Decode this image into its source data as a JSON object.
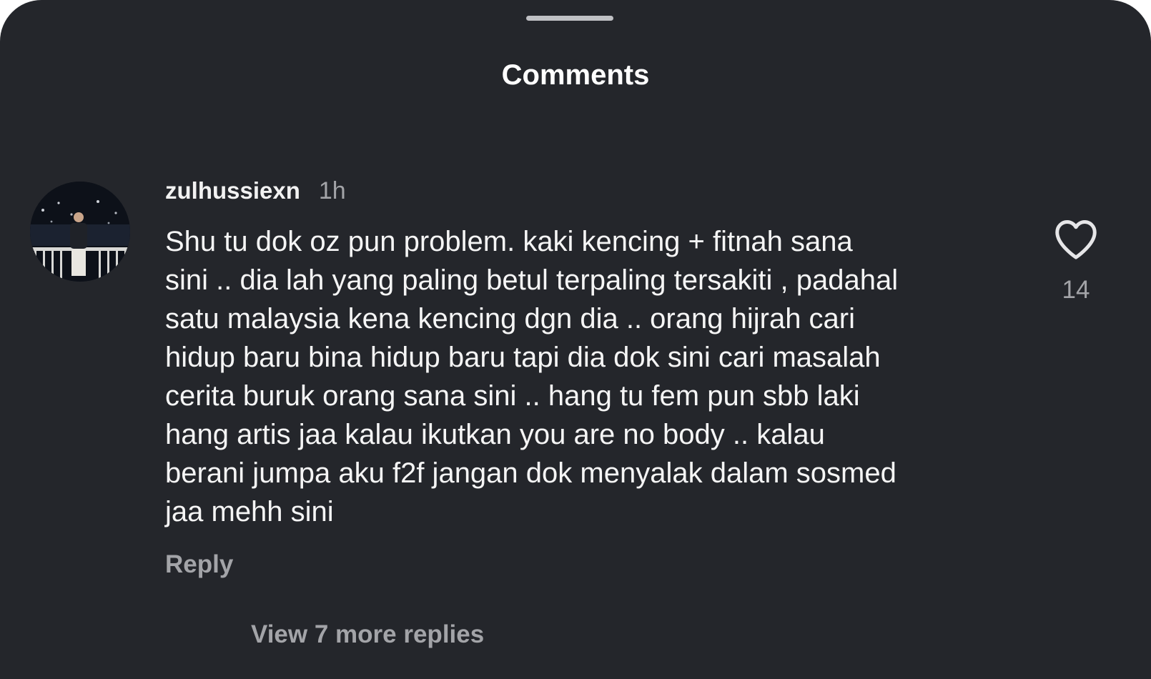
{
  "header": {
    "title": "Comments"
  },
  "comment": {
    "username": "zulhussiexn",
    "time": "1h",
    "text_lines": [
      "Shu tu dok oz pun problem. kaki kencing + fitnah sana",
      "sini .. dia lah yang paling betul terpaling tersakiti , padahal",
      "satu malaysia kena kencing dgn dia .. orang hijrah cari",
      "hidup baru bina hidup baru tapi dia dok sini cari masalah",
      "cerita buruk orang sana sini .. hang tu fem pun sbb laki",
      "hang artis jaa kalau ikutkan you are no body .. kalau",
      "berani jumpa aku f2f jangan dok menyalak dalam sosmed",
      "jaa mehh sini"
    ],
    "reply_label": "Reply",
    "like_count": "14",
    "like_icon": "heart-outline-icon",
    "view_replies_label": "View 7 more replies"
  },
  "colors": {
    "background": "#24262b",
    "primary_text": "#f5f5f5",
    "secondary_text": "#a3a4a8"
  }
}
